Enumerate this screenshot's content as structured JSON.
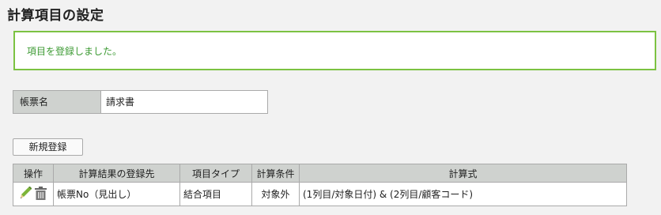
{
  "page": {
    "title": "計算項目の設定"
  },
  "message": {
    "text": "項目を登録しました。"
  },
  "form": {
    "label": "帳票名",
    "value": "請求書"
  },
  "toolbar": {
    "new_label": "新規登録"
  },
  "table": {
    "headers": [
      "操作",
      "計算結果の登録先",
      "項目タイプ",
      "計算条件",
      "計算式"
    ],
    "rows": [
      {
        "actions": [
          "edit-icon",
          "trash-icon"
        ],
        "target": "帳票No（見出し）",
        "type": "結合項目",
        "condition": "対象外",
        "formula": "(1列目/対象日付) & (2列目/顧客コード)"
      }
    ]
  },
  "colors": {
    "accent_green": "#7cc242",
    "message_text": "#3c9a33",
    "header_bg": "#cfd2cf"
  }
}
